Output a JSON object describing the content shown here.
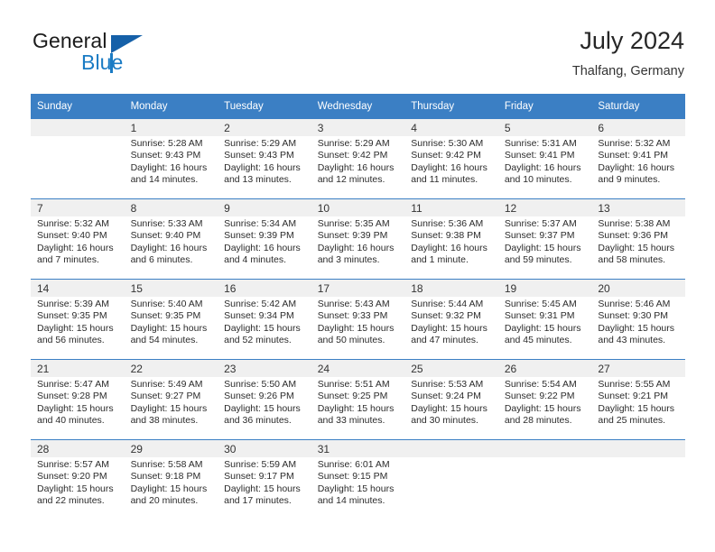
{
  "brand": {
    "name_part1": "General",
    "name_part2": "Blue",
    "triangle_icon": "brand-triangle-icon",
    "accent_color": "#1a7bc4",
    "dark_accent_color": "#1560a8"
  },
  "header": {
    "title": "July 2024",
    "subtitle": "Thalfang, Germany"
  },
  "theme": {
    "header_row_bg": "#3b7fc4",
    "daynum_band_bg": "#f0f0f0",
    "text_color": "#2b2b2b"
  },
  "calendar": {
    "weekday_headers": [
      "Sunday",
      "Monday",
      "Tuesday",
      "Wednesday",
      "Thursday",
      "Friday",
      "Saturday"
    ],
    "weeks": [
      [
        {
          "day": "",
          "sunrise": "",
          "sunset": "",
          "daylight_line1": "",
          "daylight_line2": ""
        },
        {
          "day": "1",
          "sunrise": "Sunrise: 5:28 AM",
          "sunset": "Sunset: 9:43 PM",
          "daylight_line1": "Daylight: 16 hours",
          "daylight_line2": "and 14 minutes."
        },
        {
          "day": "2",
          "sunrise": "Sunrise: 5:29 AM",
          "sunset": "Sunset: 9:43 PM",
          "daylight_line1": "Daylight: 16 hours",
          "daylight_line2": "and 13 minutes."
        },
        {
          "day": "3",
          "sunrise": "Sunrise: 5:29 AM",
          "sunset": "Sunset: 9:42 PM",
          "daylight_line1": "Daylight: 16 hours",
          "daylight_line2": "and 12 minutes."
        },
        {
          "day": "4",
          "sunrise": "Sunrise: 5:30 AM",
          "sunset": "Sunset: 9:42 PM",
          "daylight_line1": "Daylight: 16 hours",
          "daylight_line2": "and 11 minutes."
        },
        {
          "day": "5",
          "sunrise": "Sunrise: 5:31 AM",
          "sunset": "Sunset: 9:41 PM",
          "daylight_line1": "Daylight: 16 hours",
          "daylight_line2": "and 10 minutes."
        },
        {
          "day": "6",
          "sunrise": "Sunrise: 5:32 AM",
          "sunset": "Sunset: 9:41 PM",
          "daylight_line1": "Daylight: 16 hours",
          "daylight_line2": "and 9 minutes."
        }
      ],
      [
        {
          "day": "7",
          "sunrise": "Sunrise: 5:32 AM",
          "sunset": "Sunset: 9:40 PM",
          "daylight_line1": "Daylight: 16 hours",
          "daylight_line2": "and 7 minutes."
        },
        {
          "day": "8",
          "sunrise": "Sunrise: 5:33 AM",
          "sunset": "Sunset: 9:40 PM",
          "daylight_line1": "Daylight: 16 hours",
          "daylight_line2": "and 6 minutes."
        },
        {
          "day": "9",
          "sunrise": "Sunrise: 5:34 AM",
          "sunset": "Sunset: 9:39 PM",
          "daylight_line1": "Daylight: 16 hours",
          "daylight_line2": "and 4 minutes."
        },
        {
          "day": "10",
          "sunrise": "Sunrise: 5:35 AM",
          "sunset": "Sunset: 9:39 PM",
          "daylight_line1": "Daylight: 16 hours",
          "daylight_line2": "and 3 minutes."
        },
        {
          "day": "11",
          "sunrise": "Sunrise: 5:36 AM",
          "sunset": "Sunset: 9:38 PM",
          "daylight_line1": "Daylight: 16 hours",
          "daylight_line2": "and 1 minute."
        },
        {
          "day": "12",
          "sunrise": "Sunrise: 5:37 AM",
          "sunset": "Sunset: 9:37 PM",
          "daylight_line1": "Daylight: 15 hours",
          "daylight_line2": "and 59 minutes."
        },
        {
          "day": "13",
          "sunrise": "Sunrise: 5:38 AM",
          "sunset": "Sunset: 9:36 PM",
          "daylight_line1": "Daylight: 15 hours",
          "daylight_line2": "and 58 minutes."
        }
      ],
      [
        {
          "day": "14",
          "sunrise": "Sunrise: 5:39 AM",
          "sunset": "Sunset: 9:35 PM",
          "daylight_line1": "Daylight: 15 hours",
          "daylight_line2": "and 56 minutes."
        },
        {
          "day": "15",
          "sunrise": "Sunrise: 5:40 AM",
          "sunset": "Sunset: 9:35 PM",
          "daylight_line1": "Daylight: 15 hours",
          "daylight_line2": "and 54 minutes."
        },
        {
          "day": "16",
          "sunrise": "Sunrise: 5:42 AM",
          "sunset": "Sunset: 9:34 PM",
          "daylight_line1": "Daylight: 15 hours",
          "daylight_line2": "and 52 minutes."
        },
        {
          "day": "17",
          "sunrise": "Sunrise: 5:43 AM",
          "sunset": "Sunset: 9:33 PM",
          "daylight_line1": "Daylight: 15 hours",
          "daylight_line2": "and 50 minutes."
        },
        {
          "day": "18",
          "sunrise": "Sunrise: 5:44 AM",
          "sunset": "Sunset: 9:32 PM",
          "daylight_line1": "Daylight: 15 hours",
          "daylight_line2": "and 47 minutes."
        },
        {
          "day": "19",
          "sunrise": "Sunrise: 5:45 AM",
          "sunset": "Sunset: 9:31 PM",
          "daylight_line1": "Daylight: 15 hours",
          "daylight_line2": "and 45 minutes."
        },
        {
          "day": "20",
          "sunrise": "Sunrise: 5:46 AM",
          "sunset": "Sunset: 9:30 PM",
          "daylight_line1": "Daylight: 15 hours",
          "daylight_line2": "and 43 minutes."
        }
      ],
      [
        {
          "day": "21",
          "sunrise": "Sunrise: 5:47 AM",
          "sunset": "Sunset: 9:28 PM",
          "daylight_line1": "Daylight: 15 hours",
          "daylight_line2": "and 40 minutes."
        },
        {
          "day": "22",
          "sunrise": "Sunrise: 5:49 AM",
          "sunset": "Sunset: 9:27 PM",
          "daylight_line1": "Daylight: 15 hours",
          "daylight_line2": "and 38 minutes."
        },
        {
          "day": "23",
          "sunrise": "Sunrise: 5:50 AM",
          "sunset": "Sunset: 9:26 PM",
          "daylight_line1": "Daylight: 15 hours",
          "daylight_line2": "and 36 minutes."
        },
        {
          "day": "24",
          "sunrise": "Sunrise: 5:51 AM",
          "sunset": "Sunset: 9:25 PM",
          "daylight_line1": "Daylight: 15 hours",
          "daylight_line2": "and 33 minutes."
        },
        {
          "day": "25",
          "sunrise": "Sunrise: 5:53 AM",
          "sunset": "Sunset: 9:24 PM",
          "daylight_line1": "Daylight: 15 hours",
          "daylight_line2": "and 30 minutes."
        },
        {
          "day": "26",
          "sunrise": "Sunrise: 5:54 AM",
          "sunset": "Sunset: 9:22 PM",
          "daylight_line1": "Daylight: 15 hours",
          "daylight_line2": "and 28 minutes."
        },
        {
          "day": "27",
          "sunrise": "Sunrise: 5:55 AM",
          "sunset": "Sunset: 9:21 PM",
          "daylight_line1": "Daylight: 15 hours",
          "daylight_line2": "and 25 minutes."
        }
      ],
      [
        {
          "day": "28",
          "sunrise": "Sunrise: 5:57 AM",
          "sunset": "Sunset: 9:20 PM",
          "daylight_line1": "Daylight: 15 hours",
          "daylight_line2": "and 22 minutes."
        },
        {
          "day": "29",
          "sunrise": "Sunrise: 5:58 AM",
          "sunset": "Sunset: 9:18 PM",
          "daylight_line1": "Daylight: 15 hours",
          "daylight_line2": "and 20 minutes."
        },
        {
          "day": "30",
          "sunrise": "Sunrise: 5:59 AM",
          "sunset": "Sunset: 9:17 PM",
          "daylight_line1": "Daylight: 15 hours",
          "daylight_line2": "and 17 minutes."
        },
        {
          "day": "31",
          "sunrise": "Sunrise: 6:01 AM",
          "sunset": "Sunset: 9:15 PM",
          "daylight_line1": "Daylight: 15 hours",
          "daylight_line2": "and 14 minutes."
        },
        {
          "day": "",
          "sunrise": "",
          "sunset": "",
          "daylight_line1": "",
          "daylight_line2": ""
        },
        {
          "day": "",
          "sunrise": "",
          "sunset": "",
          "daylight_line1": "",
          "daylight_line2": ""
        },
        {
          "day": "",
          "sunrise": "",
          "sunset": "",
          "daylight_line1": "",
          "daylight_line2": ""
        }
      ]
    ]
  }
}
